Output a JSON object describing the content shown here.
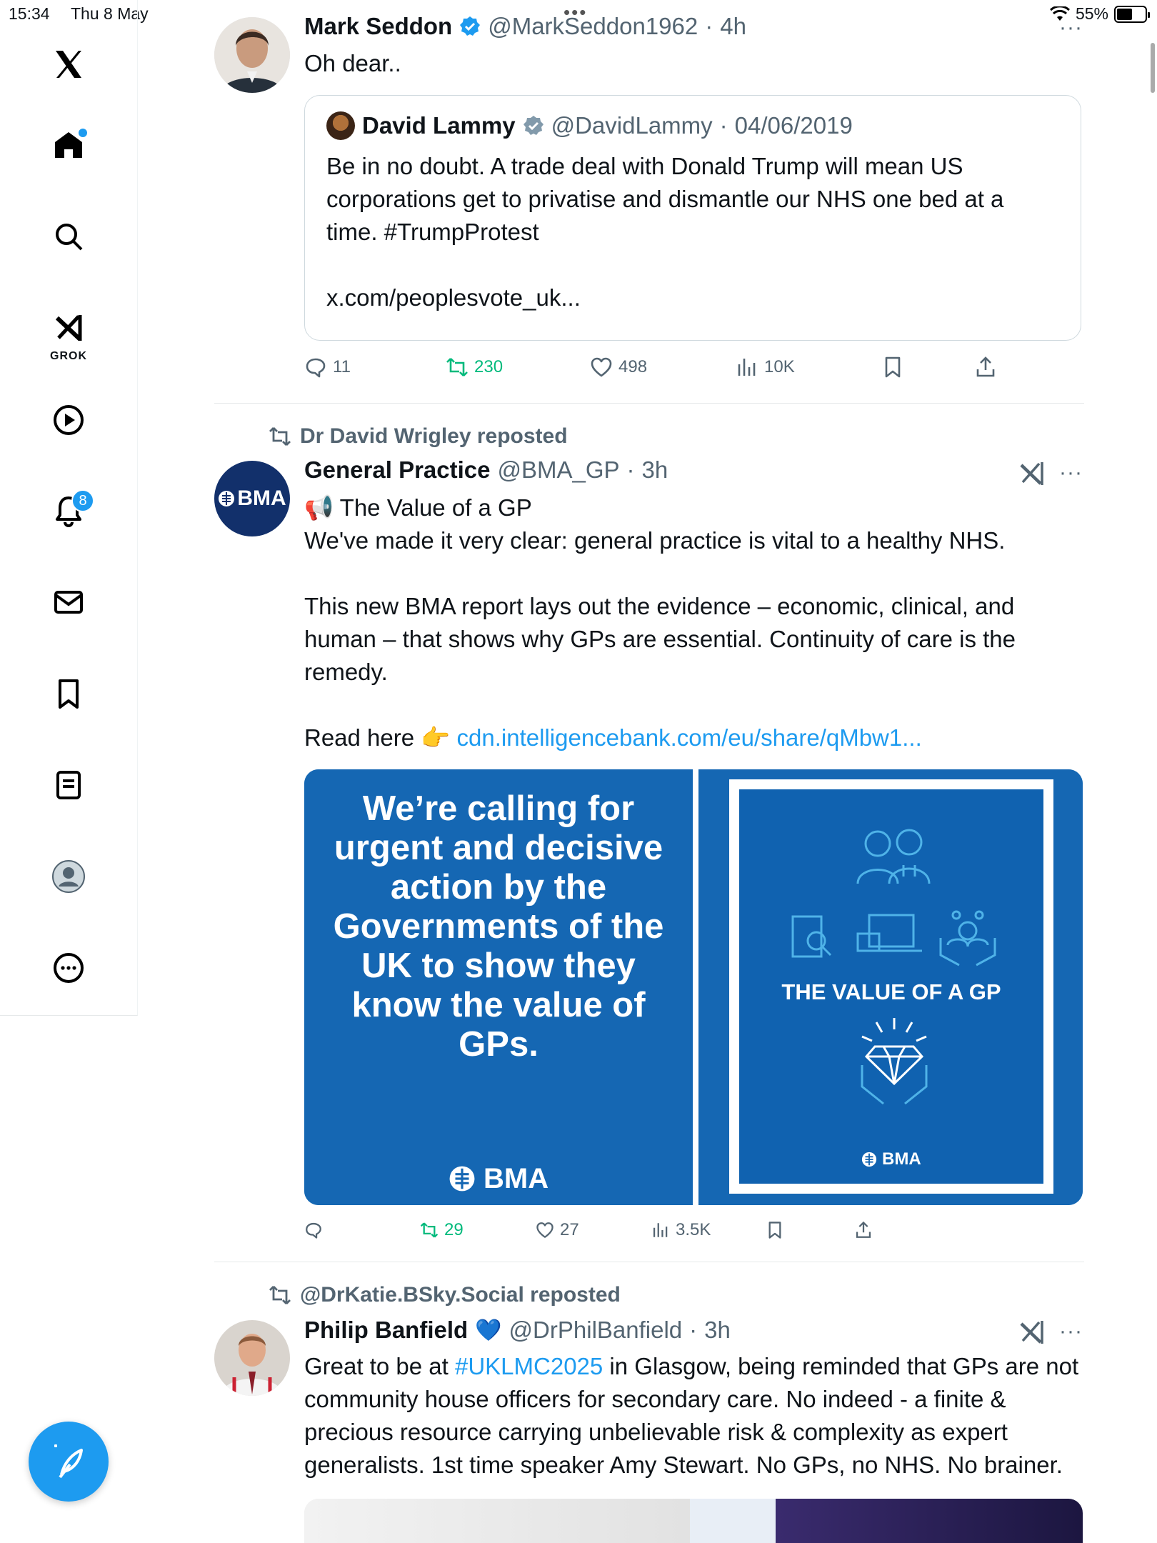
{
  "status_bar": {
    "time": "15:34",
    "date": "Thu 8 May",
    "top_dots": "•••",
    "battery": "55%",
    "battery_level": 0.55
  },
  "nav": {
    "grok_label": "GROK",
    "notifications_count": "8"
  },
  "tweets": [
    {
      "name": "Mark Seddon",
      "handle": "@MarkSeddon1962",
      "time": "4h",
      "text": "Oh dear..",
      "quote": {
        "name": "David Lammy",
        "handle": "@DavidLammy",
        "date": "04/06/2019",
        "text_1": "Be in no doubt. A trade deal with Donald Trump will mean US corporations get to privatise and dismantle our NHS one bed at a time. #TrumpProtest",
        "text_2": "x.com/peoplesvote_uk..."
      },
      "stats": {
        "replies": "11",
        "reposts": "230",
        "likes": "498",
        "views": "10K"
      }
    },
    {
      "reposted_by": "Dr David Wrigley reposted",
      "name": "General Practice",
      "handle": "@BMA_GP",
      "time": "3h",
      "avatar_label": "BMA",
      "text_title": "📢 The Value of a GP",
      "text_1": "We've made it very clear: general practice is vital to a healthy NHS.",
      "text_2": "This new BMA report lays out the evidence – economic, clinical, and human – that shows why GPs are essential. Continuity of care is the remedy.",
      "text_3": "Read here 👉",
      "link": "cdn.intelligencebank.com/eu/share/qMbw1...",
      "media": {
        "left_text": "We’re calling for urgent and decisive action by the Governments of the UK to show they know the value of GPs.",
        "left_brand": "BMA",
        "cover_title": "THE VALUE OF A GP",
        "cover_brand": "BMA"
      },
      "stats": {
        "replies": "",
        "reposts": "29",
        "likes": "27",
        "views": "3.5K"
      }
    },
    {
      "reposted_by": "@DrKatie.BSky.Social reposted",
      "name": "Philip Banfield",
      "heart": "💙",
      "handle": "@DrPhilBanfield",
      "time": "3h",
      "text_pre": "Great to be at ",
      "hashtag": "#UKLMC2025",
      "text_post": " in Glasgow, being reminded that GPs are not community  house officers for secondary care. No indeed - a finite & precious resource carrying unbelievable risk & complexity as expert generalists. 1st time speaker Amy Stewart. No GPs, no NHS. No brainer."
    }
  ],
  "colors": {
    "accent": "#1d9bf0",
    "repost_green": "#00ba7c",
    "muted": "#536471",
    "bma_blue": "#1567b3"
  }
}
